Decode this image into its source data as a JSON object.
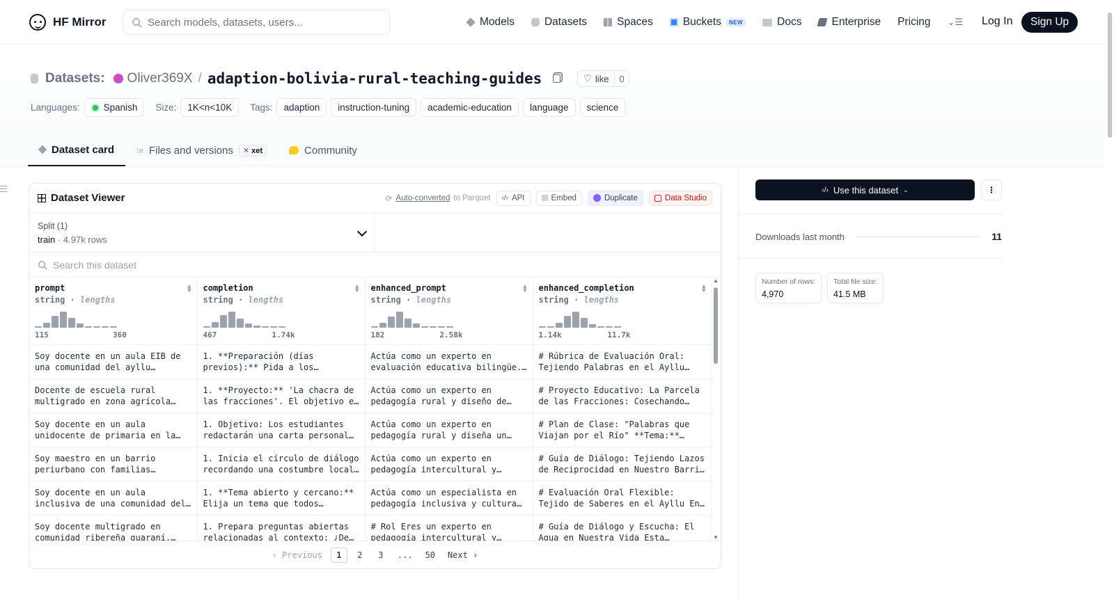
{
  "nav": {
    "brand": "HF Mirror",
    "search_placeholder": "Search models, datasets, users...",
    "items": [
      {
        "label": "Models",
        "icon": "cube-icon",
        "color": "#9ca3af"
      },
      {
        "label": "Datasets",
        "icon": "database-icon",
        "color": "#9ca3af"
      },
      {
        "label": "Spaces",
        "icon": "grid-icon",
        "color": "#9ca3af"
      },
      {
        "label": "Buckets",
        "icon": "bucket-icon",
        "color": "#3b82f6"
      },
      {
        "label": "Docs",
        "icon": "book-icon",
        "color": "#9ca3af"
      },
      {
        "label": "Enterprise",
        "icon": "enterprise-icon",
        "color": "#6b7280"
      },
      {
        "label": "Pricing"
      }
    ],
    "buckets_badge": "NEW",
    "login": "Log In",
    "signup": "Sign Up"
  },
  "header": {
    "prefix": "Datasets:",
    "owner": "Oliver369X",
    "separator": "/",
    "name": "adaption-bolivia-rural-teaching-guides",
    "like_label": "like",
    "like_count": "0",
    "languages_label": "Languages:",
    "language": "Spanish",
    "size_label": "Size:",
    "size": "1K<n<10K",
    "tags_label": "Tags:",
    "tags": [
      "adaption",
      "instruction-tuning",
      "academic-education",
      "language",
      "science"
    ]
  },
  "tabs": {
    "card": "Dataset card",
    "files": "Files and versions",
    "xet": "xet",
    "community": "Community"
  },
  "viewer": {
    "title": "Dataset Viewer",
    "converted_link": "Auto-converted",
    "converted_suffix": "to Parquet",
    "api": "API",
    "embed": "Embed",
    "duplicate": "Duplicate",
    "studio": "Data Studio",
    "split_label": "Split (1)",
    "split_value": "train",
    "split_dot": "·",
    "split_rows": "4.97k rows",
    "search_placeholder": "Search this dataset",
    "columns": [
      {
        "name": "prompt",
        "type": "string",
        "stat": "lengths",
        "min": "115",
        "max": "360",
        "hist": [
          0.1,
          0.3,
          0.7,
          0.95,
          0.6,
          0.25,
          0.1,
          0.05,
          0.05,
          0.05
        ]
      },
      {
        "name": "completion",
        "type": "string",
        "stat": "lengths",
        "min": "467",
        "max": "1.74k",
        "hist": [
          0.1,
          0.35,
          0.75,
          0.95,
          0.55,
          0.25,
          0.12,
          0.05,
          0.05,
          0.05
        ]
      },
      {
        "name": "enhanced_prompt",
        "type": "string",
        "stat": "lengths",
        "min": "182",
        "max": "2.58k",
        "hist": [
          0.05,
          0.3,
          0.65,
          0.95,
          0.55,
          0.25,
          0.1,
          0.05,
          0.05,
          0.05
        ]
      },
      {
        "name": "enhanced_completion",
        "type": "string",
        "stat": "lengths",
        "min": "1.14k",
        "max": "11.7k",
        "hist": [
          0.05,
          0.1,
          0.3,
          0.7,
          0.95,
          0.6,
          0.2,
          0.08,
          0.05,
          0.05
        ]
      }
    ],
    "rows": [
      [
        "Soy docente en un aula EIB de una comunidad del ayllu…",
        "1. **Preparación (días previos):** Pida a los…",
        "Actúa como un experto en evaluación educativa bilingüe.…",
        "# Rúbrica de Evaluación Oral: Tejiendo Palabras en el Ayllu…"
      ],
      [
        "Docente de escuela rural multigrado en zona agrícola…",
        "1. **Proyecto:** 'La chacra de las fracciones'. El objetivo e…",
        "Actúa como un experto en pedagogía rural y diseño de…",
        "# Proyecto Educativo: La Parcela de las Fracciones: Cosechando…"
      ],
      [
        "Soy docente en un aula unidocente de primaria en la…",
        "1. Objetivo: Los estudiantes redactarán una carta personal…",
        "Actúa como un experto en pedagogía rural y diseña un…",
        "# Plan de Clase: \"Palabras que Viajan por el Río\" **Tema:**…"
      ],
      [
        "Soy maestro en un barrio periurbano con familias…",
        "1. Inicia el círculo de diálogo recordando una costumbre local…",
        "Actúa como un experto en pedagogía intercultural y…",
        "# Guía de Diálogo: Tejiendo Lazos de Reciprocidad en Nuestro Barri…"
      ],
      [
        "Soy docente en un aula inclusiva de una comunidad del…",
        "1. **Tema abierto y cercano:** Elija un tema que todos…",
        "Actúa como un especialista en pedagogía inclusiva y cultura…",
        "# Evaluación Oral Flexible: Tejido de Saberes en el Ayllu En…"
      ],
      [
        "Soy docente multigrado en comunidad ribereña guaraní.…",
        "1. Prepara preguntas abiertas relacionadas al contexto: ¿De…",
        "# Rol Eres un experto en pedagogía intercultural y…",
        "# Guía de Diálogo y Escucha: El Agua en Nuestra Vida Esta…"
      ]
    ],
    "pager": {
      "prev": "Previous",
      "pages": [
        "1",
        "2",
        "3",
        "...",
        "50"
      ],
      "next": "Next"
    }
  },
  "sidebar": {
    "use_button": "Use this dataset",
    "downloads_label": "Downloads last month",
    "downloads": "11",
    "rows_label": "Number of rows:",
    "rows": "4,970",
    "size_label": "Total file size:",
    "size": "41.5 MB"
  }
}
